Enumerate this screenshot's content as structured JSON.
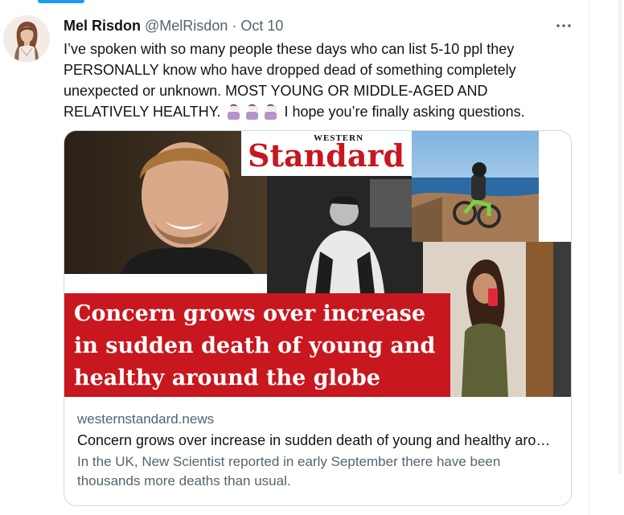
{
  "tweet": {
    "author_name": "Mel Risdon",
    "author_handle": "@MelRisdon",
    "separator": "·",
    "date": "Oct 10",
    "more_icon": "more-dots-icon",
    "text_part1": "I’ve spoken with so many people these days who can list 5-10 ppl they PERSONALLY know who have dropped dead of something completely unexpected or unknown. MOST YOUNG OR MIDDLE-AGED AND RELATIVELY HEALTHY.",
    "emoji_icon": "person-raising-hand-emoji",
    "text_part2": "I hope you’re finally asking questions."
  },
  "card": {
    "logo_small": "WESTERN",
    "logo_big": "Standard",
    "headline_lines": [
      "Concern grows over increase",
      "in sudden death of young and",
      "healthy around the globe"
    ],
    "domain": "westernstandard.news",
    "title": "Concern grows over increase in sudden death of young and healthy around the globe",
    "description": "In the UK, New Scientist reported in early September there have been thousands more deaths than usual.",
    "colors": {
      "banner_red": "#c8171e",
      "logo_red": "#c8171e"
    }
  }
}
